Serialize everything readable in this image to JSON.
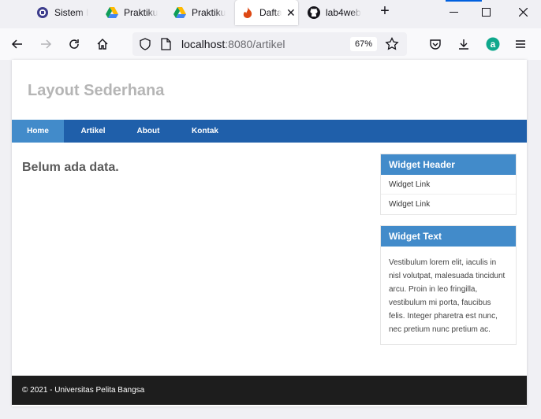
{
  "browser": {
    "tabs": [
      {
        "label": "Sistem I",
        "icon": "university-seal-icon"
      },
      {
        "label": "Praktiku",
        "icon": "google-drive-icon"
      },
      {
        "label": "Praktiku",
        "icon": "google-drive-icon"
      },
      {
        "label": "Dafta",
        "icon": "codeigniter-flame-icon",
        "active": true
      },
      {
        "label": "lab4web",
        "icon": "github-icon"
      }
    ],
    "url_host": "localhost",
    "url_path": ":8080/artikel",
    "zoom": "67%"
  },
  "site": {
    "title": "Layout Sederhana",
    "nav": [
      "Home",
      "Artikel",
      "About",
      "Kontak"
    ],
    "active_nav": "Home",
    "message": "Belum ada data.",
    "widget1": {
      "header": "Widget Header",
      "links": [
        "Widget Link",
        "Widget Link"
      ]
    },
    "widget2": {
      "header": "Widget Text",
      "body": "Vestibulum lorem elit, iaculis in nisl volutpat, malesuada tincidunt arcu. Proin in leo fringilla, vestibulum mi porta, faucibus felis. Integer pharetra est nunc, nec pretium nunc pretium ac."
    },
    "footer": "© 2021 - Universitas Pelita Bangsa"
  },
  "colors": {
    "nav_bg": "#1f5faa",
    "nav_active": "#428bca",
    "widget_header": "#428bca",
    "footer_bg": "#1d1d1d"
  }
}
